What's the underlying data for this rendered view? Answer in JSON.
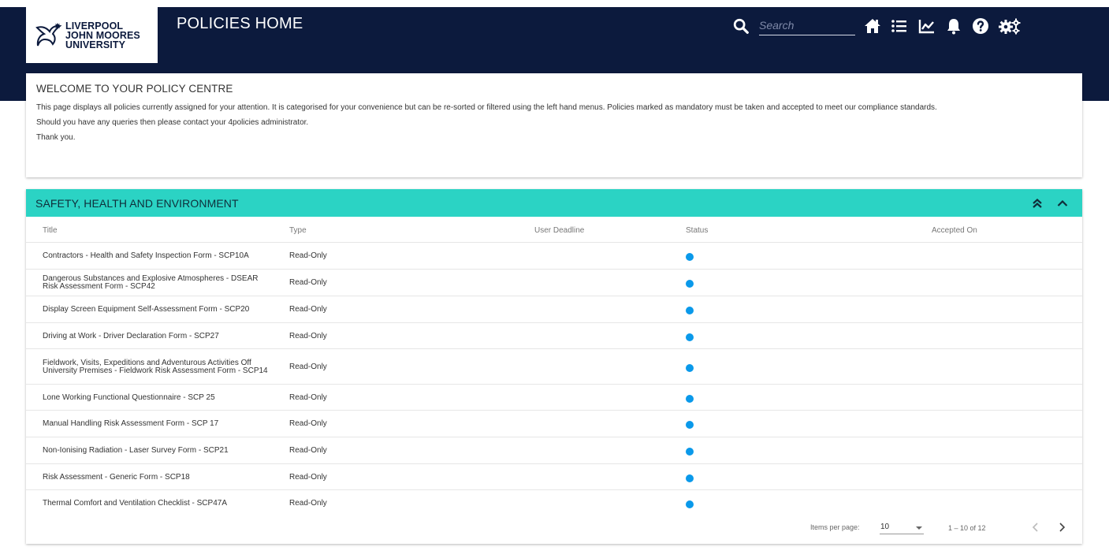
{
  "brand": {
    "logo_line1": "LIVERPOOL",
    "logo_line2": "JOHN MOORES",
    "logo_line3": "UNIVERSITY",
    "navy": "#0c1a3d",
    "teal": "#2bd3c4",
    "status_blue": "#0a99ea"
  },
  "header": {
    "page_title": "POLICIES HOME",
    "search_placeholder": "Search",
    "nav_icons": [
      "home-icon",
      "list-icon",
      "chart-icon",
      "bell-icon",
      "help-icon",
      "settings-icon"
    ]
  },
  "welcome": {
    "heading": "WELCOME TO YOUR POLICY CENTRE",
    "paragraph1": "This page displays all policies currently assigned for your attention. It is categorised for your convenience but can be re-sorted or filtered using the left hand menus. Policies marked as mandatory must be taken and accepted to meet our compliance standards.",
    "paragraph2": "Should you have any queries then please contact your 4policies administrator.",
    "paragraph3": "Thank you."
  },
  "section": {
    "title": "SAFETY, HEALTH AND ENVIRONMENT",
    "columns": {
      "title": "Title",
      "type": "Type",
      "deadline": "User Deadline",
      "status": "Status",
      "accepted": "Accepted On"
    },
    "rows": [
      {
        "title": "Contractors - Health and Safety Inspection Form - SCP10A",
        "type": "Read-Only",
        "deadline": "",
        "status": "blue-dot",
        "accepted": ""
      },
      {
        "title": "Dangerous Substances and Explosive Atmospheres - DSEAR Risk Assessment Form - SCP42",
        "type": "Read-Only",
        "deadline": "",
        "status": "blue-dot",
        "accepted": ""
      },
      {
        "title": "Display Screen Equipment Self-Assessment Form - SCP20",
        "type": "Read-Only",
        "deadline": "",
        "status": "blue-dot",
        "accepted": ""
      },
      {
        "title": "Driving at Work - Driver Declaration Form - SCP27",
        "type": "Read-Only",
        "deadline": "",
        "status": "blue-dot",
        "accepted": ""
      },
      {
        "title": "Fieldwork, Visits, Expeditions and Adventurous Activities Off University Premises - Fieldwork Risk Assessment Form - SCP14",
        "type": "Read-Only",
        "deadline": "",
        "status": "blue-dot",
        "accepted": ""
      },
      {
        "title": "Lone Working Functional Questionnaire - SCP 25",
        "type": "Read-Only",
        "deadline": "",
        "status": "blue-dot",
        "accepted": ""
      },
      {
        "title": "Manual Handling Risk Assessment Form - SCP 17",
        "type": "Read-Only",
        "deadline": "",
        "status": "blue-dot",
        "accepted": ""
      },
      {
        "title": "Non-Ionising Radiation - Laser Survey Form - SCP21",
        "type": "Read-Only",
        "deadline": "",
        "status": "blue-dot",
        "accepted": ""
      },
      {
        "title": "Risk Assessment - Generic Form - SCP18",
        "type": "Read-Only",
        "deadline": "",
        "status": "blue-dot",
        "accepted": ""
      },
      {
        "title": "Thermal Comfort and Ventilation Checklist - SCP47A",
        "type": "Read-Only",
        "deadline": "",
        "status": "blue-dot",
        "accepted": ""
      }
    ]
  },
  "paginator": {
    "label": "Items per page:",
    "page_size": "10",
    "range": "1 – 10 of 12"
  }
}
